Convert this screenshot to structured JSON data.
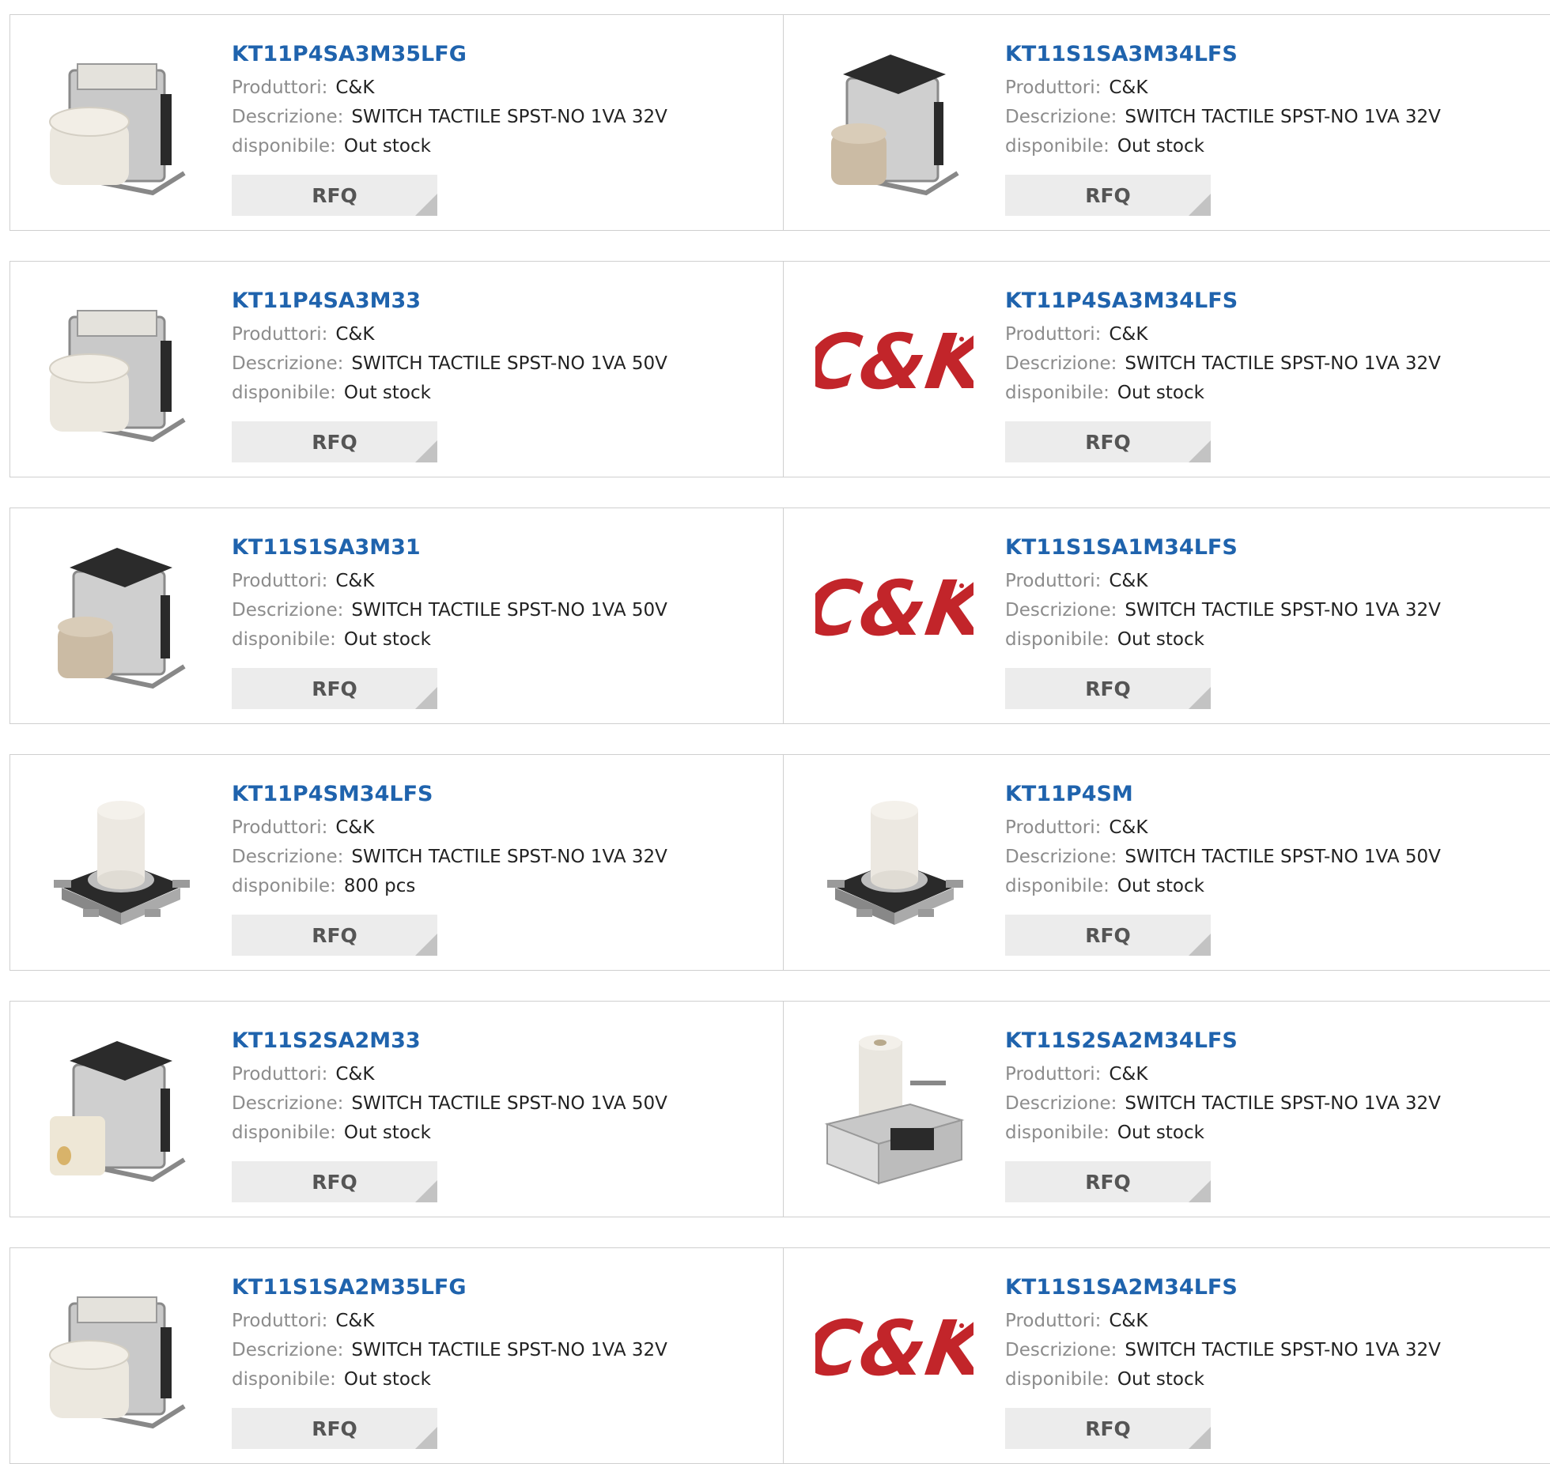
{
  "labels": {
    "manufacturer": "Produttori:",
    "description": "Descrizione:",
    "availability": "disponibile:",
    "rfq": "RFQ"
  },
  "colors": {
    "title": "#1f63ad",
    "label": "#8c8c8c",
    "border": "#cfcfcf",
    "rfq_bg": "#ececec",
    "logo_red": "#c2252a"
  },
  "products": [
    {
      "part": "KT11P4SA3M35LFG",
      "manufacturer": "C&K",
      "description": "SWITCH TACTILE SPST-NO 1VA 32V",
      "availability": "Out stock",
      "image": "switch-white-bracket-icon"
    },
    {
      "part": "KT11S1SA3M34LFS",
      "manufacturer": "C&K",
      "description": "SWITCH TACTILE SPST-NO 1VA 32V",
      "availability": "Out stock",
      "image": "switch-beige-bracket-icon"
    },
    {
      "part": "KT11P4SA3M33",
      "manufacturer": "C&K",
      "description": "SWITCH TACTILE SPST-NO 1VA 50V",
      "availability": "Out stock",
      "image": "switch-white-bracket-icon"
    },
    {
      "part": "KT11P4SA3M34LFS",
      "manufacturer": "C&K",
      "description": "SWITCH TACTILE SPST-NO 1VA 32V",
      "availability": "Out stock",
      "image": "ck-logo"
    },
    {
      "part": "KT11S1SA3M31",
      "manufacturer": "C&K",
      "description": "SWITCH TACTILE SPST-NO 1VA 50V",
      "availability": "Out stock",
      "image": "switch-beige-bracket-icon"
    },
    {
      "part": "KT11S1SA1M34LFS",
      "manufacturer": "C&K",
      "description": "SWITCH TACTILE SPST-NO 1VA 32V",
      "availability": "Out stock",
      "image": "ck-logo"
    },
    {
      "part": "KT11P4SM34LFS",
      "manufacturer": "C&K",
      "description": "SWITCH TACTILE SPST-NO 1VA 32V",
      "availability": "800 pcs",
      "image": "switch-smd-icon"
    },
    {
      "part": "KT11P4SM",
      "manufacturer": "C&K",
      "description": "SWITCH TACTILE SPST-NO 1VA 50V",
      "availability": "Out stock",
      "image": "switch-smd-icon"
    },
    {
      "part": "KT11S2SA2M33",
      "manufacturer": "C&K",
      "description": "SWITCH TACTILE SPST-NO 1VA 50V",
      "availability": "Out stock",
      "image": "switch-hollow-bracket-icon"
    },
    {
      "part": "KT11S2SA2M34LFS",
      "manufacturer": "C&K",
      "description": "SWITCH TACTILE SPST-NO 1VA 32V",
      "availability": "Out stock",
      "image": "switch-upright-icon"
    },
    {
      "part": "KT11S1SA2M35LFG",
      "manufacturer": "C&K",
      "description": "SWITCH TACTILE SPST-NO 1VA 32V",
      "availability": "Out stock",
      "image": "switch-white-bracket-icon"
    },
    {
      "part": "KT11S1SA2M34LFS",
      "manufacturer": "C&K",
      "description": "SWITCH TACTILE SPST-NO 1VA 32V",
      "availability": "Out stock",
      "image": "ck-logo"
    }
  ]
}
